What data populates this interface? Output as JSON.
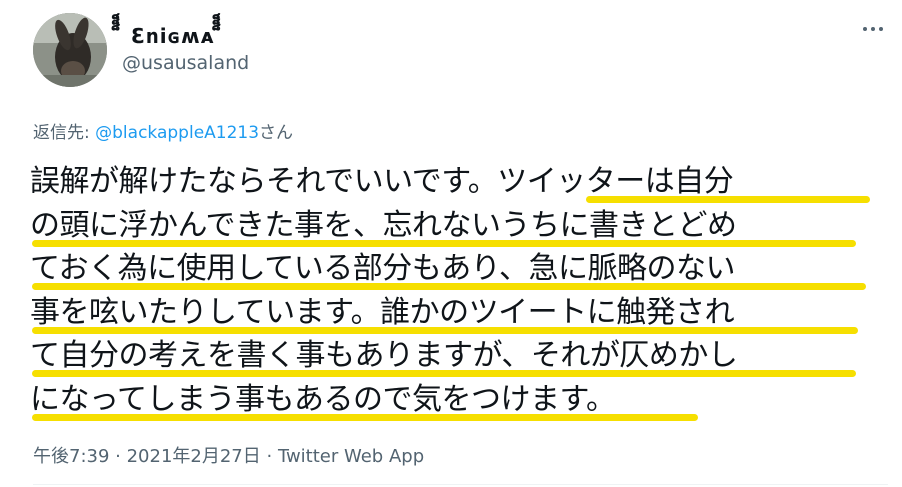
{
  "author": {
    "display_name": "็็็ Ɛոіɢʍᴀ ็็็",
    "handle": "@usausaland"
  },
  "reply": {
    "prefix": "返信先:",
    "target": "@blackappleA1213",
    "suffix": "さん"
  },
  "tweet": {
    "lines": [
      "誤解が解けたならそれでいいです。ツイッターは自分",
      "の頭に浮かんできた事を、忘れないうちに書きとどめ",
      "ておく為に使用している部分もあり、急に脈略のない",
      "事を呟いたりしています。誰かのツイートに触発され",
      "て自分の考えを書く事もありますが、それが仄めかし",
      "になってしまう事もあるので気をつけます。"
    ]
  },
  "meta": {
    "timestamp": "午後7:39 · 2021年2月27日",
    "separator": " · ",
    "app": "Twitter Web App"
  },
  "colors": {
    "highlight": "#f6df00",
    "link": "#1d9bf0",
    "secondary_text": "#536471"
  },
  "icons": {
    "more": "more-horizontal-icon"
  }
}
